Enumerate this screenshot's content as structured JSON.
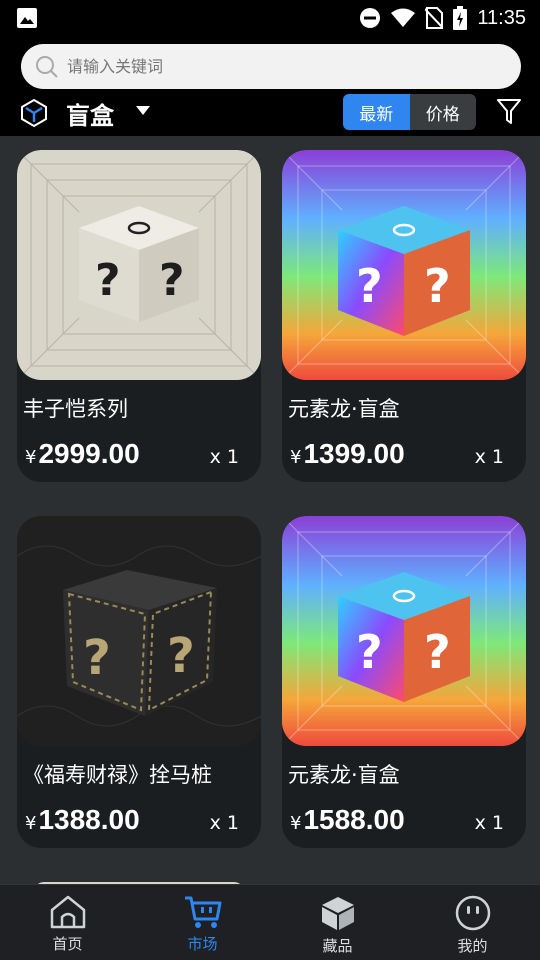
{
  "status_bar": {
    "time": "11:35"
  },
  "search": {
    "placeholder": "请输入关键词"
  },
  "category": {
    "title": "盲盒"
  },
  "sort": {
    "newest_label": "最新",
    "price_label": "价格"
  },
  "products": [
    {
      "name": "丰子恺系列",
      "currency": "¥",
      "price": "2999.00",
      "qty": "x 1",
      "theme": "beige"
    },
    {
      "name": "元素龙·盲盒",
      "currency": "¥",
      "price": "1399.00",
      "qty": "x 1",
      "theme": "rainbow"
    },
    {
      "name": "《福寿财禄》拴马桩",
      "currency": "¥",
      "price": "1388.00",
      "qty": "x 1",
      "theme": "dark"
    },
    {
      "name": "元素龙·盲盒",
      "currency": "¥",
      "price": "1588.00",
      "qty": "x 1",
      "theme": "rainbow"
    }
  ],
  "bottom_nav": [
    {
      "label": "首页",
      "icon": "home-icon"
    },
    {
      "label": "市场",
      "icon": "cart-icon",
      "active": true
    },
    {
      "label": "藏品",
      "icon": "box-icon"
    },
    {
      "label": "我的",
      "icon": "profile-icon"
    }
  ],
  "colors": {
    "accent": "#2f86f0",
    "card_bg": "#1b1e20",
    "page_bg": "#2b2f31"
  }
}
